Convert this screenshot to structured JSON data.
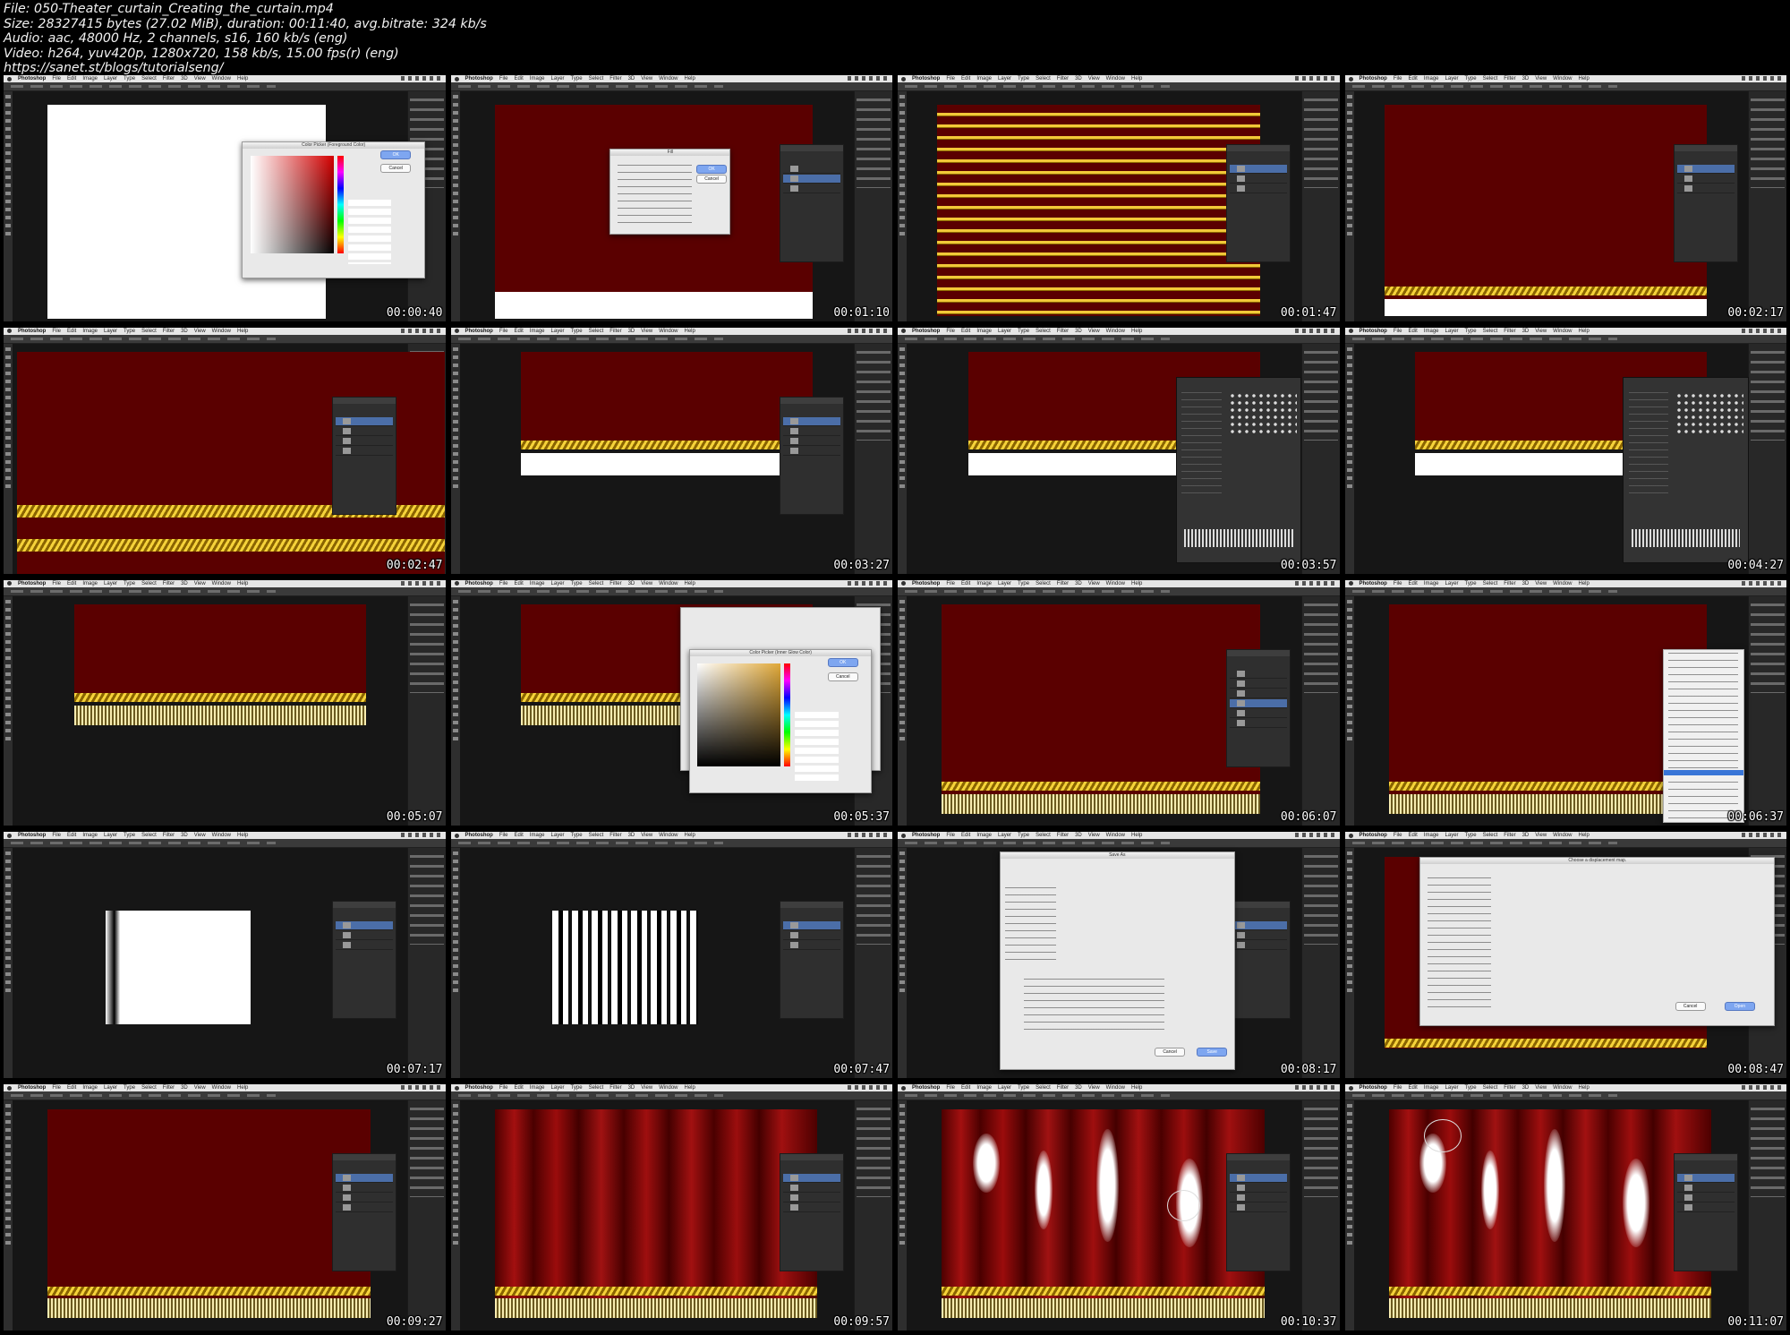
{
  "header": {
    "file": "File: 050-Theater_curtain_Creating_the_curtain.mp4",
    "size": "Size: 28327415 bytes (27.02 MiB), duration: 00:11:40, avg.bitrate: 324 kb/s",
    "audio": "Audio: aac, 48000 Hz, 2 channels, s16, 160 kb/s (eng)",
    "video": "Video: h264, yuv420p, 1280x720, 158 kb/s, 15.00 fps(r) (eng)",
    "url": "https://sanet.st/blogs/tutorialseng/"
  },
  "app": {
    "name": "Photoshop",
    "menus": [
      "File",
      "Edit",
      "Image",
      "Layer",
      "Type",
      "Select",
      "Filter",
      "3D",
      "View",
      "Window",
      "Help"
    ]
  },
  "thumbnails": [
    {
      "time": "00:00:40",
      "scene": "color-picker-red",
      "dialog_title": "Color Picker (Foreground Color)",
      "ok": "OK",
      "cancel": "Cancel"
    },
    {
      "time": "00:01:10",
      "scene": "fill-dialog",
      "dialog_title": "Fill",
      "ok": "OK",
      "cancel": "Cancel"
    },
    {
      "time": "00:01:47",
      "scene": "rope-stripes"
    },
    {
      "time": "00:02:17",
      "scene": "rope-bottom"
    },
    {
      "time": "00:02:47",
      "scene": "rope-zoom"
    },
    {
      "time": "00:03:27",
      "scene": "rope-white"
    },
    {
      "time": "00:03:57",
      "scene": "brush-panel"
    },
    {
      "time": "00:04:27",
      "scene": "brush-panel"
    },
    {
      "time": "00:05:07",
      "scene": "fringe"
    },
    {
      "time": "00:05:37",
      "scene": "layer-style",
      "dialog_title": "Color Picker (Inner Glow Color)",
      "ok": "OK",
      "cancel": "Cancel"
    },
    {
      "time": "00:06:07",
      "scene": "fringe-full"
    },
    {
      "time": "00:06:37",
      "scene": "context-menu"
    },
    {
      "time": "00:07:17",
      "scene": "single-fold"
    },
    {
      "time": "00:07:47",
      "scene": "zebra"
    },
    {
      "time": "00:08:17",
      "scene": "save-as",
      "dialog_title": "Save As",
      "save": "Save",
      "cancel": "Cancel"
    },
    {
      "time": "00:08:47",
      "scene": "displacement-map",
      "dialog_title": "Choose a displacement map.",
      "ok": "Open",
      "cancel": "Cancel"
    },
    {
      "time": "00:09:27",
      "scene": "curtain-flat"
    },
    {
      "time": "00:09:57",
      "scene": "curtain-folds"
    },
    {
      "time": "00:10:37",
      "scene": "curtain-highlights"
    },
    {
      "time": "00:11:07",
      "scene": "curtain-highlights-brush"
    }
  ],
  "colors": {
    "curtain_red": "#5a0000",
    "rope_gold": "#f5d23a",
    "panel_gray": "#2f2f2f",
    "menu_bar": "#e6e6e6",
    "selection_blue": "#3875d7"
  }
}
